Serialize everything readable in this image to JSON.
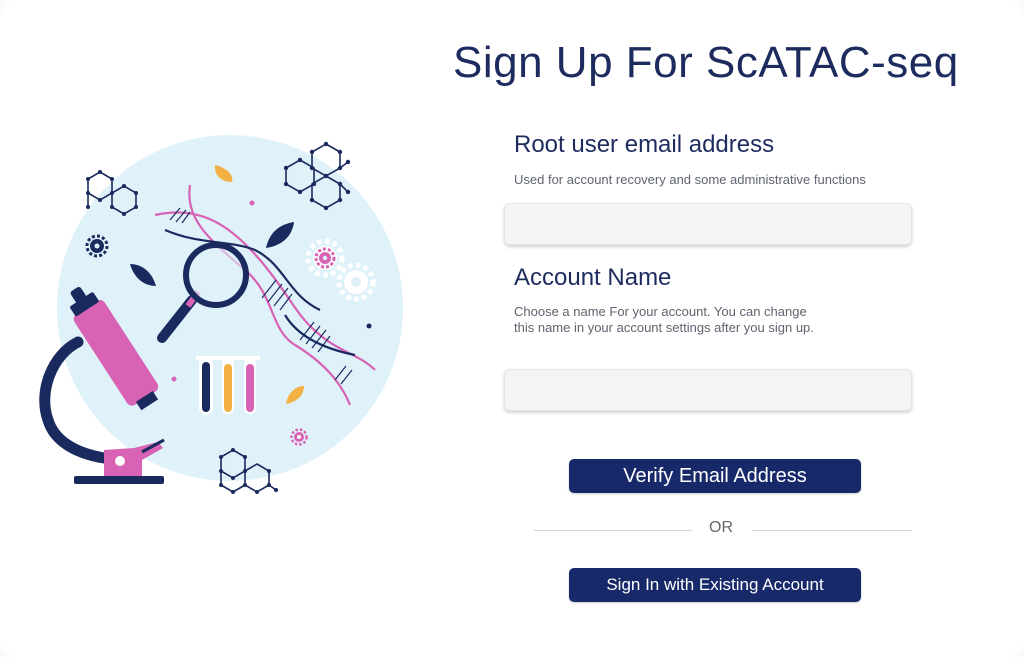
{
  "page": {
    "title": "Sign Up For ScATAC-seq"
  },
  "form": {
    "email": {
      "label": "Root user email address",
      "help": "Used for account recovery and some administrative functions",
      "value": "",
      "placeholder": ""
    },
    "account_name": {
      "label": "Account Name",
      "help_line1": "Choose a name For your account. You can change",
      "help_line2": "this name in your account settings after you sign up.",
      "value": "",
      "placeholder": ""
    },
    "verify_button": "Verify Email Address",
    "divider_text": "OR",
    "signin_button": "Sign In with Existing Account"
  },
  "colors": {
    "primary": "#18296a",
    "title": "#1d2b5e",
    "illustration_bg": "#dff2fa",
    "pink": "#d862b3",
    "orange": "#f2b142",
    "navy": "#1b2a5e"
  },
  "illustration": {
    "icons": [
      "microscope-icon",
      "magnifier-icon",
      "dna-helix-icon",
      "test-tubes-icon",
      "gear-icon",
      "leaf-icon",
      "molecule-icon"
    ]
  }
}
